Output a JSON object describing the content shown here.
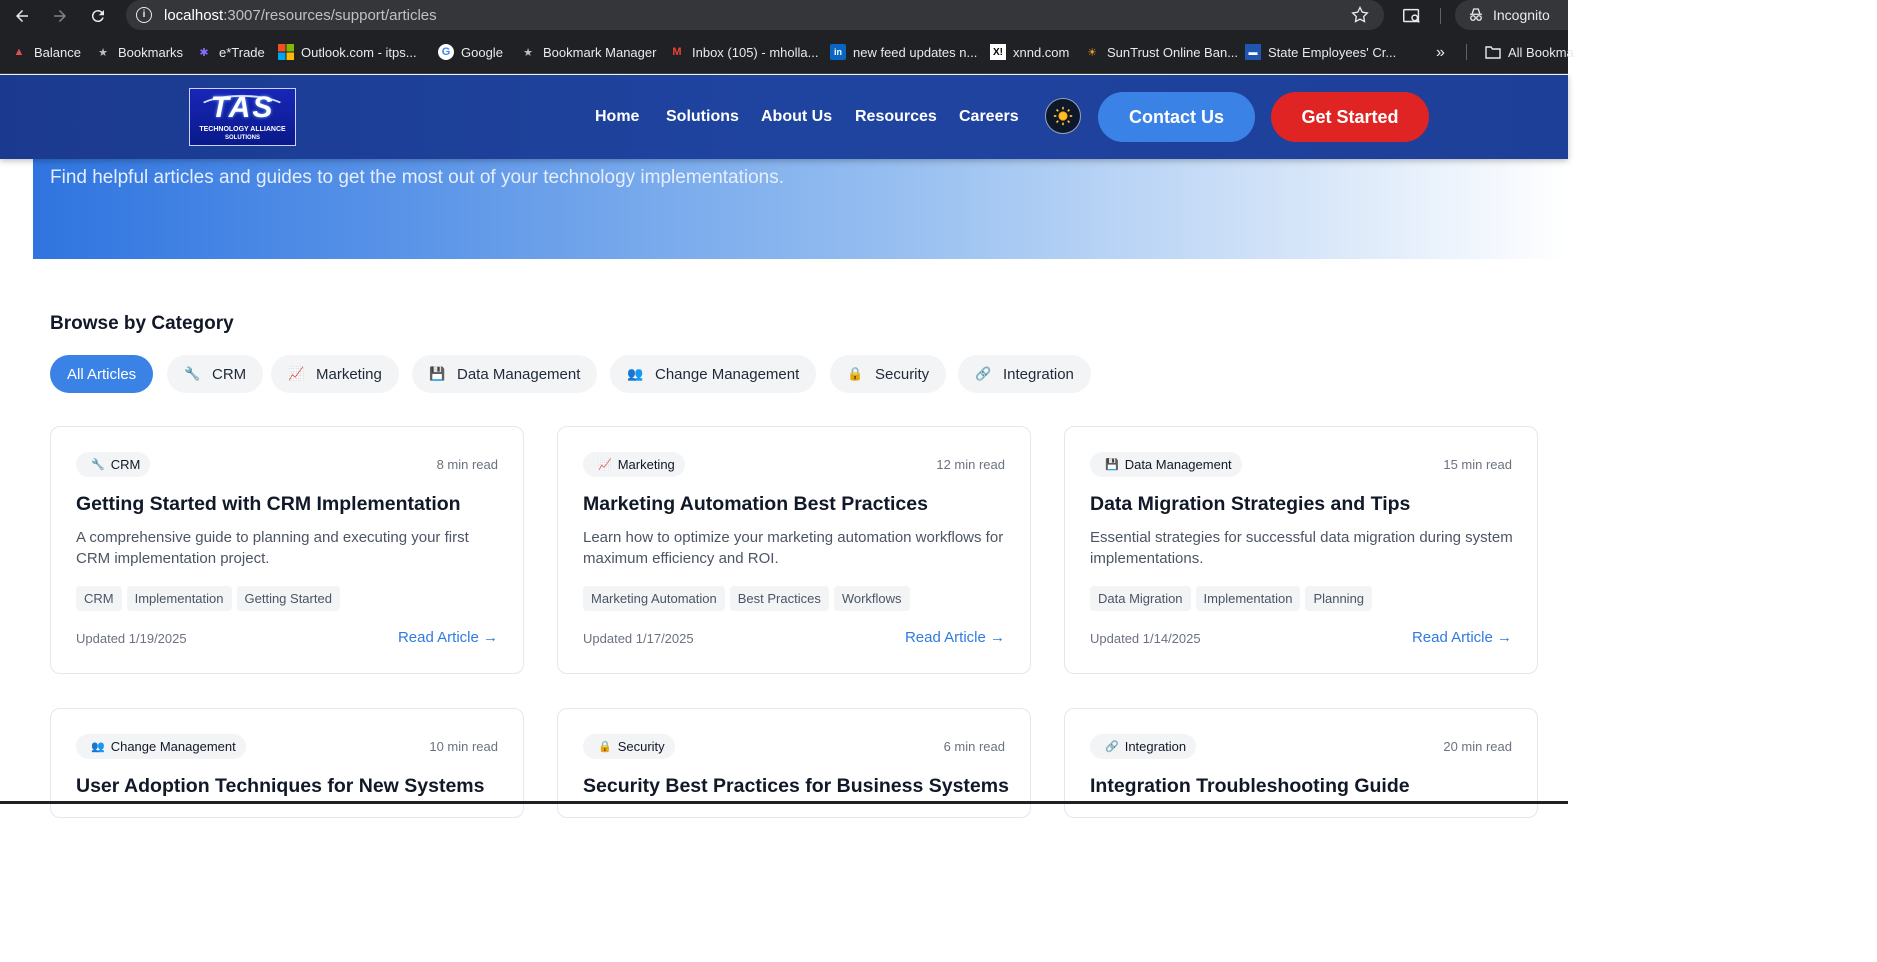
{
  "browser": {
    "url_host": "localhost",
    "url_path": ":3007/resources/support/articles",
    "profile_label": "Incognito",
    "bookmarks": [
      {
        "label": "Balance"
      },
      {
        "label": "Bookmarks"
      },
      {
        "label": "e*Trade"
      },
      {
        "label": "Outlook.com - itps..."
      },
      {
        "label": "Google"
      },
      {
        "label": "Bookmark Manager"
      },
      {
        "label": "Inbox (105) - mholla..."
      },
      {
        "label": "new feed updates n..."
      },
      {
        "label": "xnnd.com"
      },
      {
        "label": "SunTrust Online Ban..."
      },
      {
        "label": "State Employees' Cr..."
      }
    ],
    "all_bookmarks_label": "All Bookma"
  },
  "header": {
    "logo_text": "TAS",
    "logo_line1": "TECHNOLOGY ALLIANCE",
    "logo_line2": "SOLUTIONS",
    "nav": [
      {
        "label": "Home"
      },
      {
        "label": "Solutions"
      },
      {
        "label": "About Us"
      },
      {
        "label": "Resources"
      },
      {
        "label": "Careers"
      }
    ],
    "contact_label": "Contact Us",
    "get_started_label": "Get Started"
  },
  "hero": {
    "subtitle": "Find helpful articles and guides to get the most out of your technology implementations."
  },
  "categories": {
    "title": "Browse by Category",
    "items": [
      {
        "label": "All Articles",
        "icon": "",
        "active": true
      },
      {
        "label": "CRM",
        "icon": "🔧"
      },
      {
        "label": "Marketing",
        "icon": "📈"
      },
      {
        "label": "Data Management",
        "icon": "💾"
      },
      {
        "label": "Change Management",
        "icon": "👥"
      },
      {
        "label": "Security",
        "icon": "🔒"
      },
      {
        "label": "Integration",
        "icon": "🔗"
      }
    ]
  },
  "articles": [
    {
      "category": "CRM",
      "icon": "🔧",
      "read_time": "8 min read",
      "title": "Getting Started with CRM Implementation",
      "description": "A comprehensive guide to planning and executing your first CRM implementation project.",
      "tags": [
        "CRM",
        "Implementation",
        "Getting Started"
      ],
      "updated": "Updated 1/19/2025",
      "link": "Read Article →"
    },
    {
      "category": "Marketing",
      "icon": "📈",
      "read_time": "12 min read",
      "title": "Marketing Automation Best Practices",
      "description": "Learn how to optimize your marketing automation workflows for maximum efficiency and ROI.",
      "tags": [
        "Marketing Automation",
        "Best Practices",
        "Workflows"
      ],
      "updated": "Updated 1/17/2025",
      "link": "Read Article →"
    },
    {
      "category": "Data Management",
      "icon": "💾",
      "read_time": "15 min read",
      "title": "Data Migration Strategies and Tips",
      "description": "Essential strategies for successful data migration during system implementations.",
      "tags": [
        "Data Migration",
        "Implementation",
        "Planning"
      ],
      "updated": "Updated 1/14/2025",
      "link": "Read Article →"
    },
    {
      "category": "Change Management",
      "icon": "👥",
      "read_time": "10 min read",
      "title": "User Adoption Techniques for New Systems",
      "description": "",
      "tags": [],
      "updated": "",
      "link": ""
    },
    {
      "category": "Security",
      "icon": "🔒",
      "read_time": "6 min read",
      "title": "Security Best Practices for Business Systems",
      "description": "",
      "tags": [],
      "updated": "",
      "link": ""
    },
    {
      "category": "Integration",
      "icon": "🔗",
      "read_time": "20 min read",
      "title": "Integration Troubleshooting Guide",
      "description": "",
      "tags": [],
      "updated": "",
      "link": ""
    }
  ],
  "colors": {
    "header_bg": "#1f44a0",
    "accent_blue": "#3b82e6",
    "cta_red": "#e02424",
    "link_blue": "#2f7be0"
  }
}
